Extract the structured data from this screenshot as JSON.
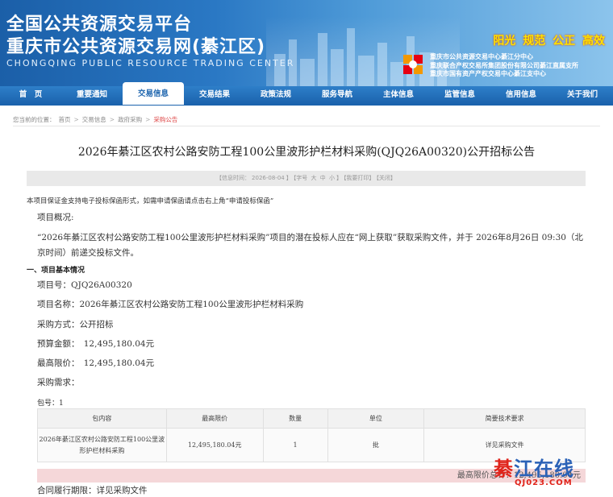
{
  "banner": {
    "title_line1": "全国公共资源交易平台",
    "title_line2": "重庆市公共资源交易网(綦江区)",
    "title_en": "CHONGQING PUBLIC RESOURCE TRADING CENTER",
    "slogan": "阳光 规范 公正 高效",
    "orgs": [
      "重庆市公共资源交易中心綦江分中心",
      "重庆联合产权交易所集团股份有限公司綦江直属支所",
      "重庆市国有资产产权交易中心綦江支中心"
    ],
    "brand_color": "#1b63ad",
    "slogan_color": "#ffe400"
  },
  "nav": {
    "items": [
      {
        "label": "首　页"
      },
      {
        "label": "重要通知"
      },
      {
        "label": "交易信息"
      },
      {
        "label": "交易结果"
      },
      {
        "label": "政策法规"
      },
      {
        "label": "服务导航"
      },
      {
        "label": "主体信息"
      },
      {
        "label": "监管信息"
      },
      {
        "label": "信用信息"
      },
      {
        "label": "关于我们"
      }
    ],
    "active_index": 2
  },
  "breadcrumb": {
    "prefix": "您当前的位置：",
    "items": [
      "首页",
      "交易信息",
      "政府采购",
      "采购公告"
    ],
    "separator": ">"
  },
  "article": {
    "title": "2026年綦江区农村公路安防工程100公里波形护栏材料采购(QJQ26A00320)公开招标公告",
    "info": {
      "date_label": "【信息时间：",
      "date": "2026-08-04",
      "date_close": "】",
      "font_label": "【字号",
      "font_sizes": [
        "大",
        "中",
        "小"
      ],
      "font_close": "】",
      "print": "【我要打印】",
      "close": "【关闭】"
    },
    "note": "本项目保证金支持电子投标保函形式，如需申请保函请点击右上角“申请投标保函”",
    "overview_label": "项目概况:",
    "overview_text": "“2026年綦江区农村公路安防工程100公里波形护栏材料采购”项目的潜在投标人应在“网上获取”获取采购文件，并于 2026年8月26日 09:30（北京时间）前递交投标文件。",
    "section1": "一、项目基本情况",
    "fields": {
      "project_no": "项目号：QJQ26A00320",
      "project_name": "项目名称：2026年綦江区农村公路安防工程100公里波形护栏材料采购",
      "method": "采购方式：公开招标",
      "budget": "预算金额：　12,495,180.04元",
      "max_price": "最高限价：　12,495,180.04元",
      "demand": "采购需求："
    },
    "package": "包号：1",
    "table": {
      "headers": [
        "包内容",
        "最高限价",
        "数量",
        "单位",
        "简要技术要求"
      ],
      "rows": [
        [
          "2026年綦江区农村公路安防工程100公里波形护栏材料采购",
          "12,495,180.04元",
          "1",
          "批",
          "详见采购文件"
        ]
      ]
    },
    "total": "最高限价总计：12,495,180.04元",
    "contract": "合同履行期限：详见采购文件"
  },
  "watermark": {
    "first": "綦",
    "rest": "江在线",
    "sub": "QJ023.COM"
  }
}
